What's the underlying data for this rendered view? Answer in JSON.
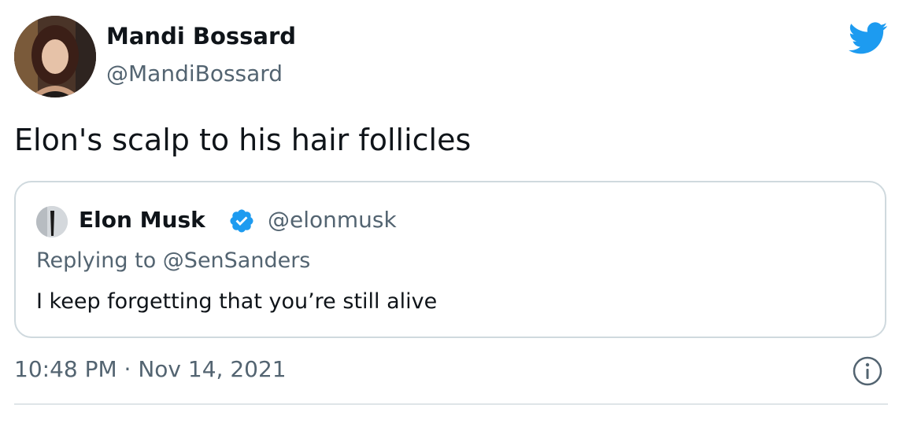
{
  "author": {
    "display_name": "Mandi Bossard",
    "handle": "@MandiBossard",
    "avatar_icon": "profile-photo"
  },
  "brand": {
    "icon": "twitter-bird-icon",
    "color": "#1d9bf0"
  },
  "tweet": {
    "text": "Elon's scalp to his hair follicles",
    "timestamp": "10:48 PM · Nov 14, 2021"
  },
  "quoted_tweet": {
    "display_name": "Elon Musk",
    "verified_icon": "verified-badge-icon",
    "handle": "@elonmusk",
    "replying_to": "Replying to @SenSanders",
    "text": "I keep forgetting that you’re still alive"
  },
  "colors": {
    "primary_text": "#0f1419",
    "secondary_text": "#536471",
    "border": "#cfd9de",
    "accent": "#1d9bf0"
  },
  "icons": {
    "info": "info-icon"
  }
}
